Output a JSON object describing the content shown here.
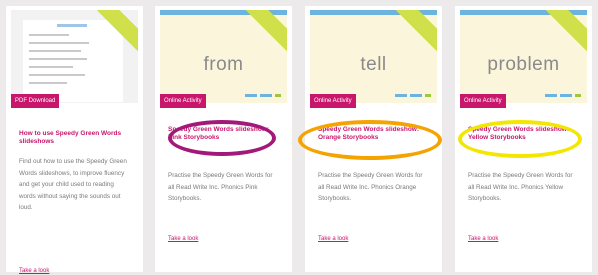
{
  "cards": [
    {
      "badge": "PDF Download",
      "title": "How to use Speedy Green Words slideshows",
      "desc": "Find out how to use the Speedy Green Words slideshows, to improve fluency and get your child used to reading words without saying the sounds out loud.",
      "link": "Take a look"
    },
    {
      "word": "from",
      "badge": "Online Activity",
      "title": "Speedy Green Words slideshow: Pink Storybooks",
      "desc": "Practise the Speedy Green Words for all Read Write Inc. Phonics Pink Storybooks.",
      "link": "Take a look"
    },
    {
      "word": "tell",
      "badge": "Online Activity",
      "title": "Speedy Green Words slideshow: Orange Storybooks",
      "desc": "Practise the Speedy Green Words for all Read Write Inc. Phonics Orange Storybooks.",
      "link": "Take a look"
    },
    {
      "word": "problem",
      "badge": "Online Activity",
      "title": "Speedy Green Words slideshow: Yellow Storybooks",
      "desc": "Practise the Speedy Green Words for all Read Write Inc. Phonics Yellow Storybooks.",
      "link": "Take a look"
    }
  ],
  "annotations": {
    "ring_colors": [
      "#a2197a",
      "#f4a300",
      "#f3e600"
    ]
  },
  "colors": {
    "accent": "#c8166c",
    "ribbon": "#cfe04a",
    "thumb_bg": "#fbf5dc"
  }
}
